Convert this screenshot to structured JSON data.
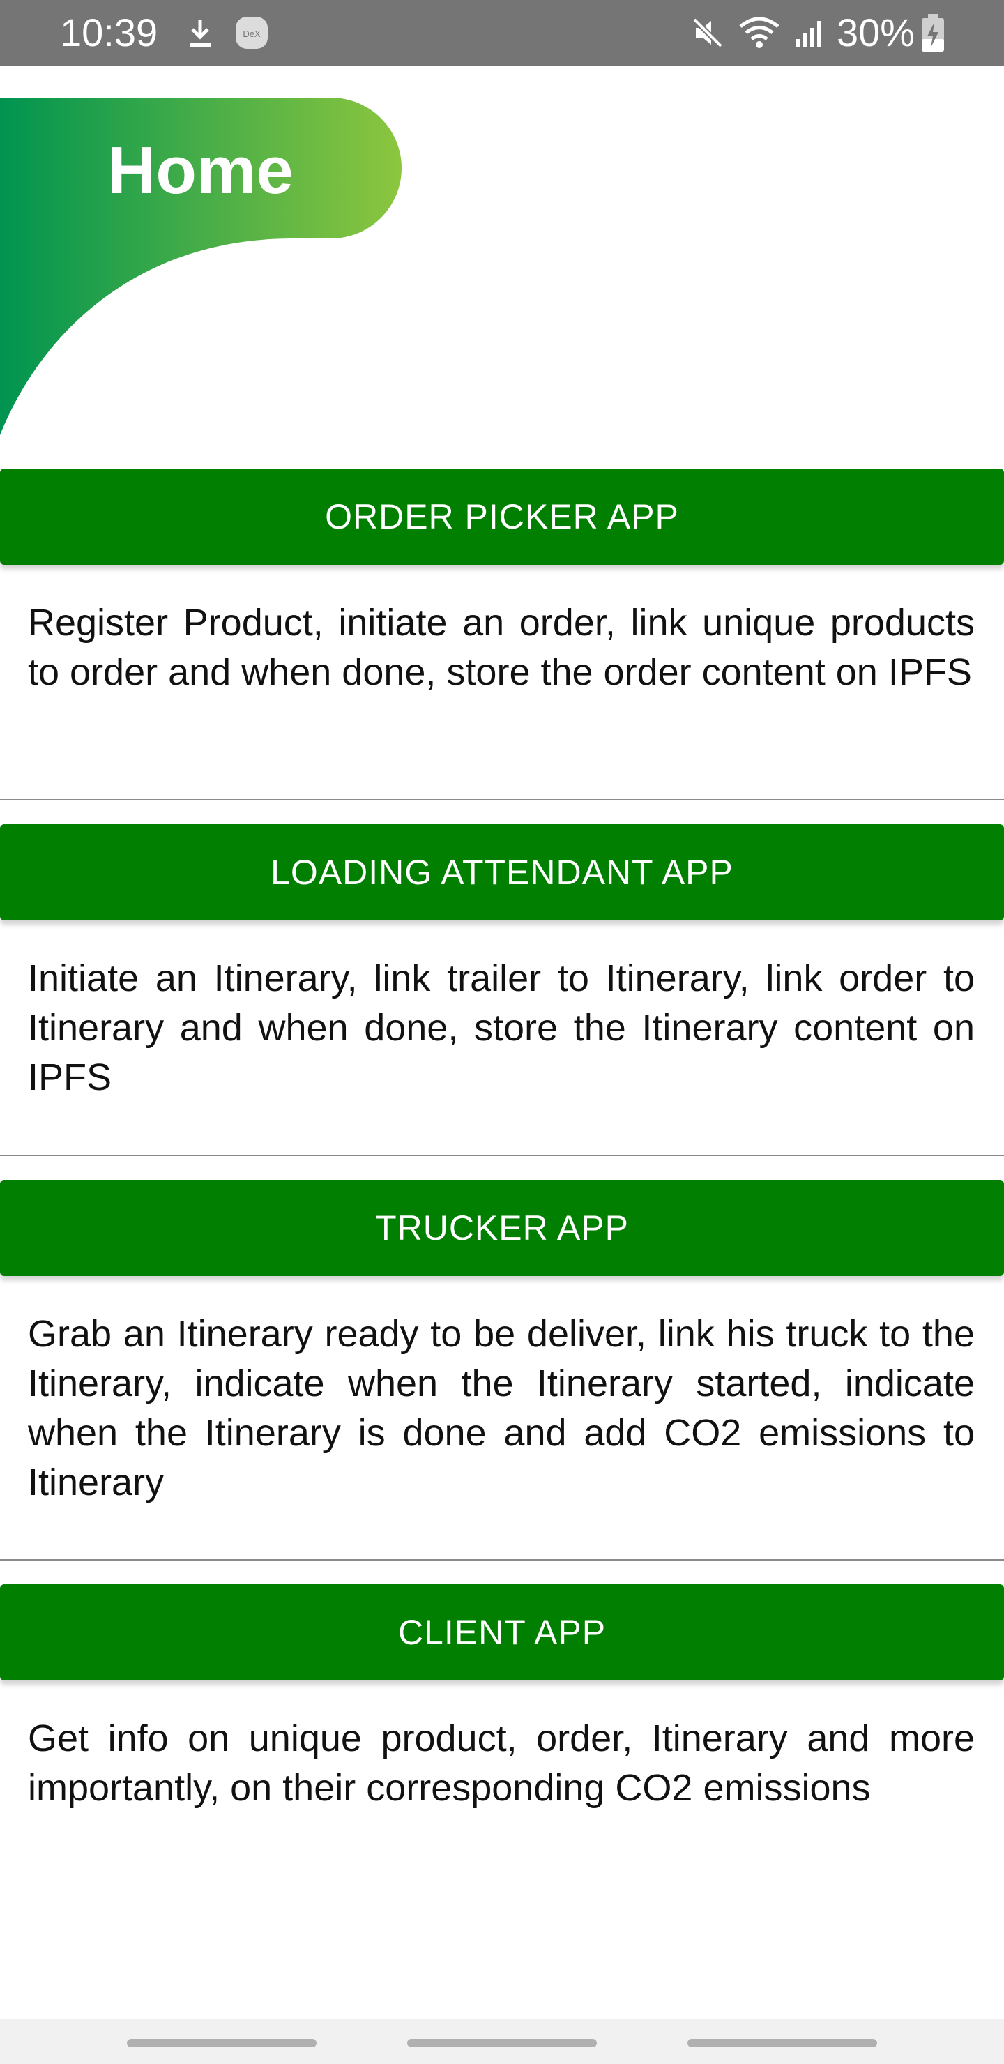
{
  "status_bar": {
    "time": "10:39",
    "battery_text": "30%",
    "icons": [
      "download-icon",
      "dex-icon",
      "mute-icon",
      "wifi-icon",
      "signal-icon",
      "battery-charging-icon"
    ],
    "dex_label": "DeX"
  },
  "header": {
    "title": "Home",
    "gradient_start": "#009450",
    "gradient_end": "#8cc63f"
  },
  "sections": [
    {
      "button_label": "ORDER PICKER APP",
      "description": "Register Product, initiate an order, link unique products to order and when done, store the order content on IPFS"
    },
    {
      "button_label": "LOADING ATTENDANT APP",
      "description": "Initiate an Itinerary, link trailer to Itinerary, link order to Itinerary and when done, store the Itinerary content on IPFS"
    },
    {
      "button_label": "TRUCKER APP",
      "description": "Grab an Itinerary ready to be deliver, link his truck to the Itinerary, indicate when the Itinerary started, indicate when the Itinerary is done and add CO2 emissions to Itinerary"
    },
    {
      "button_label": "CLIENT APP",
      "description": "Get info on unique product, order, Itinerary and more importantly, on their corresponding CO2 emissions"
    }
  ],
  "colors": {
    "button": "#007f00",
    "status_bar": "#757575"
  }
}
